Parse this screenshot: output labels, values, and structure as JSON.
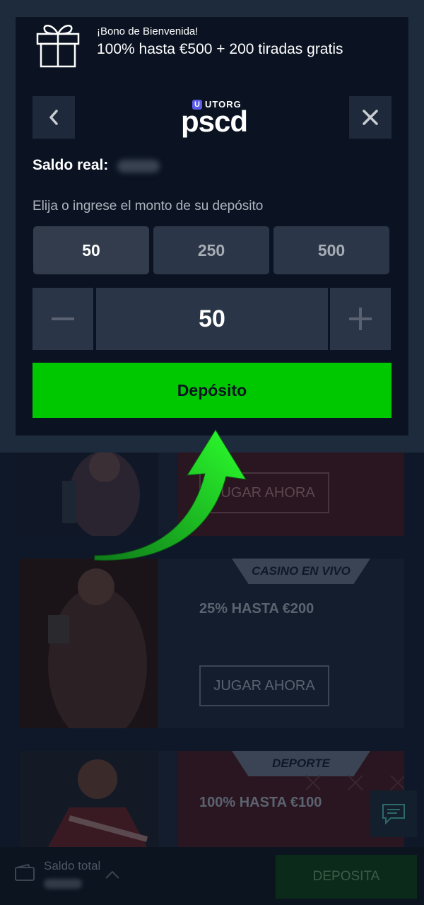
{
  "modal": {
    "bonus_small": "¡Bono de Bienvenida!",
    "bonus_big": "100% hasta €500 + 200 tiradas gratis",
    "brand_small": "UTORG",
    "brand_big": "pscd",
    "saldo_label": "Saldo real:",
    "prompt": "Elija o ingrese el monto de su depósito",
    "amounts": [
      "50",
      "250",
      "500"
    ],
    "stepper_value": "50",
    "deposit_label": "Depósito"
  },
  "promos": [
    {
      "tag": "",
      "title": "",
      "button": "JUGAR AHORA"
    },
    {
      "tag": "CASINO EN VIVO",
      "title": "25% HASTA €200",
      "button": "JUGAR AHORA"
    },
    {
      "tag": "DEPORTE",
      "title": "100% HASTA €100",
      "button": ""
    }
  ],
  "bottom": {
    "saldo_total": "Saldo total",
    "deposita": "DEPOSITA"
  },
  "colors": {
    "accent_green": "#00c800",
    "modal_bg": "#0b1322",
    "page_bg": "#0f1828"
  },
  "icons": [
    "gift-icon",
    "back-arrow-icon",
    "close-icon",
    "minus-icon",
    "plus-icon",
    "wallet-icon",
    "chevron-up-icon",
    "chat-icon"
  ]
}
